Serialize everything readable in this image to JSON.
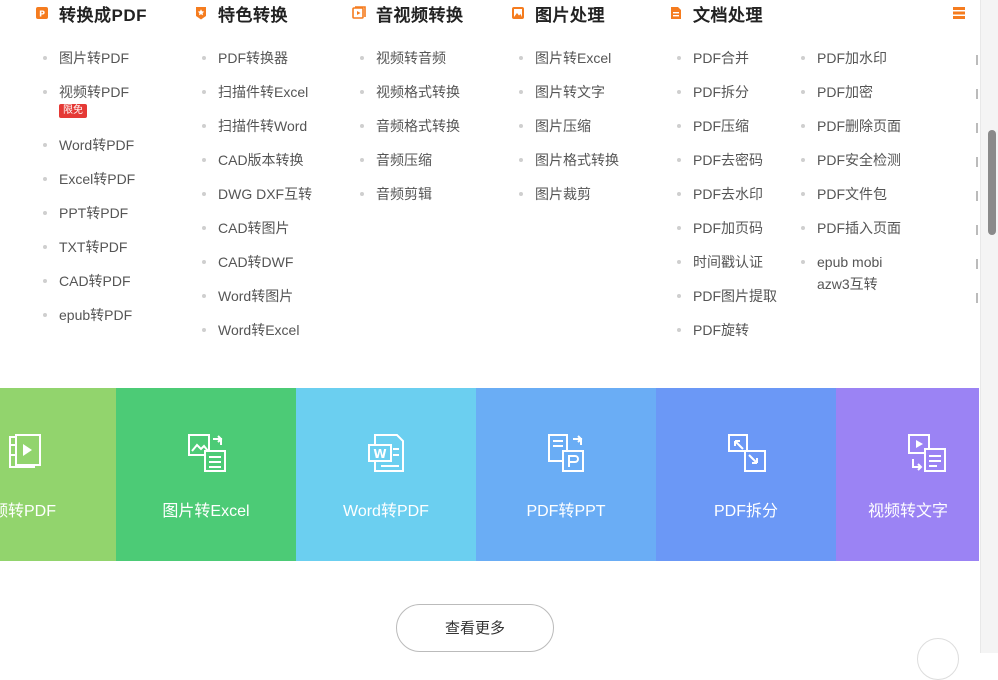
{
  "columns": [
    {
      "title": "转换成PDF",
      "icon": "pdf-convert-icon",
      "items": [
        "图片转PDF",
        "视频转PDF",
        "Word转PDF",
        "Excel转PDF",
        "PPT转PDF",
        "TXT转PDF",
        "CAD转PDF",
        "epub转PDF"
      ],
      "badge_item": 1,
      "badge": "限免"
    },
    {
      "title": "特色转换",
      "icon": "star-badge-icon",
      "items": [
        "PDF转换器",
        "扫描件转Excel",
        "扫描件转Word",
        "CAD版本转换",
        "DWG DXF互转",
        "CAD转图片",
        "CAD转DWF",
        "Word转图片",
        "Word转Excel"
      ]
    },
    {
      "title": "音视频转换",
      "icon": "video-icon",
      "items": [
        "视频转音频",
        "视频格式转换",
        "音频格式转换",
        "音频压缩",
        "音频剪辑"
      ]
    },
    {
      "title": "图片处理",
      "icon": "image-icon",
      "items": [
        "图片转Excel",
        "图片转文字",
        "图片压缩",
        "图片格式转换",
        "图片裁剪"
      ]
    },
    {
      "title": "文档处理",
      "icon": "document-icon",
      "items": [
        "PDF合并",
        "PDF拆分",
        "PDF压缩",
        "PDF去密码",
        "PDF去水印",
        "PDF加页码",
        "时间戳认证",
        "PDF图片提取",
        "PDF旋转"
      ],
      "items2": [
        "PDF加水印",
        "PDF加密",
        "PDF删除页面",
        "PDF安全检测",
        "PDF文件包",
        "PDF插入页面",
        "epub mobi azw3互转"
      ]
    }
  ],
  "tiles": [
    {
      "label": "视频转PDF",
      "icon": "video-pdf-icon",
      "color": "#92d46d"
    },
    {
      "label": "图片转Excel",
      "icon": "image-excel-icon",
      "color": "#4ccb76"
    },
    {
      "label": "Word转PDF",
      "icon": "word-file-icon",
      "color": "#6bcff0"
    },
    {
      "label": "PDF转PPT",
      "icon": "pdf-ppt-icon",
      "color": "#6aadf5"
    },
    {
      "label": "PDF拆分",
      "icon": "pdf-split-icon",
      "color": "#6b98f6"
    },
    {
      "label": "视频转文字",
      "icon": "video-text-icon",
      "color": "#9b83f4"
    }
  ],
  "more_button": "查看更多",
  "colors": {
    "accent_orange": "#f57c1f",
    "badge_red": "#e53935"
  }
}
